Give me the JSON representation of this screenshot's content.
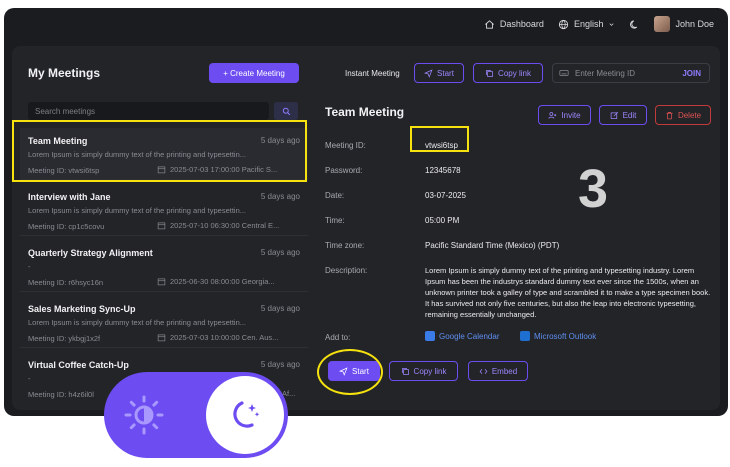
{
  "topbar": {
    "dashboard": "Dashboard",
    "language": "English",
    "user": "John Doe"
  },
  "left": {
    "title": "My Meetings",
    "create_button": "+ Create Meeting",
    "search_placeholder": "Search meetings"
  },
  "instant": {
    "label": "Instant Meeting",
    "start": "Start",
    "copy_link": "Copy link",
    "meeting_id_placeholder": "Enter Meeting ID",
    "join": "JOIN"
  },
  "meetings": [
    {
      "name": "Team Meeting",
      "ago": "5 days ago",
      "desc": "Lorem Ipsum is simply dummy text of the printing and typesettin...",
      "id": "Meeting ID: vtwsi6tsp",
      "time": "2025-07-03 17:00:00 Pacific S..."
    },
    {
      "name": "Interview with Jane",
      "ago": "5 days ago",
      "desc": "Lorem Ipsum is simply dummy text of the printing and typesettin...",
      "id": "Meeting ID: cp1c5covu",
      "time": "2025-07-10 06:30:00 Central E..."
    },
    {
      "name": "Quarterly Strategy Alignment",
      "ago": "5 days ago",
      "desc": "-",
      "id": "Meeting ID: r6hsyc16n",
      "time": "2025-06-30 08:00:00 Georgia..."
    },
    {
      "name": "Sales Marketing Sync-Up",
      "ago": "5 days ago",
      "desc": "Lorem Ipsum is simply dummy text of the printing and typesettin...",
      "id": "Meeting ID: ykbgj1x2f",
      "time": "2025-07-03 10:00:00 Cen. Aus..."
    },
    {
      "name": "Virtual Coffee Catch-Up",
      "ago": "5 days ago",
      "desc": "-",
      "id": "Meeting ID: h4z6il0l",
      "time": "Af..."
    }
  ],
  "detail": {
    "title": "Team Meeting",
    "invite": "Invite",
    "edit": "Edit",
    "delete": "Delete",
    "labels": {
      "meeting_id": "Meeting ID:",
      "password": "Password:",
      "date": "Date:",
      "time": "Time:",
      "timezone": "Time zone:",
      "description": "Description:",
      "add_to": "Add to:"
    },
    "values": {
      "meeting_id": "vtwsi6tsp",
      "password": "12345678",
      "date": "03-07-2025",
      "time": "05:00 PM",
      "timezone": "Pacific Standard Time (Mexico) (PDT)",
      "description": "Lorem Ipsum is simply dummy text of the printing and typesetting industry. Lorem Ipsum has been the industrys standard dummy text ever since the 1500s, when an unknown printer took a galley of type and scrambled it to make a type specimen book. It has survived not only five centuries, but also the leap into electronic typesetting, remaining essentially unchanged."
    },
    "google_calendar": "Google Calendar",
    "outlook": "Microsoft Outlook",
    "start": "Start",
    "copy_link": "Copy link",
    "embed": "Embed"
  },
  "annotation_number": "3",
  "colors": {
    "accent": "#6d4df2",
    "highlight": "#f5e20e",
    "background": "#1b1c1f",
    "danger": "#e05252"
  }
}
